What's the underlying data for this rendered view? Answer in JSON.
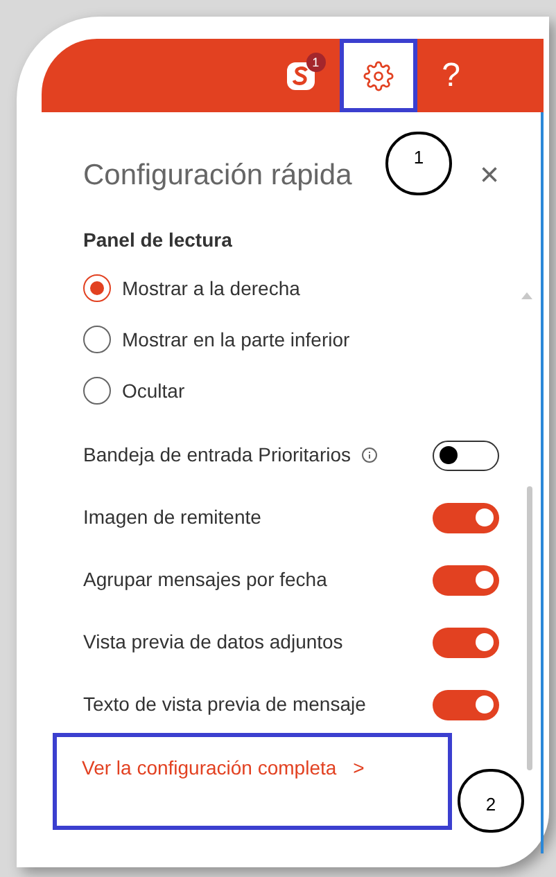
{
  "header": {
    "skype_badge": "1",
    "help_label": "?"
  },
  "panel": {
    "title": "Configuración rápida",
    "close_label": "×",
    "reading_pane": {
      "heading": "Panel de lectura",
      "options": [
        {
          "label": "Mostrar a la derecha",
          "selected": true
        },
        {
          "label": "Mostrar en la parte inferior",
          "selected": false
        },
        {
          "label": "Ocultar",
          "selected": false
        }
      ]
    },
    "toggles": [
      {
        "label": "Bandeja de entrada Prioritarios",
        "info": true,
        "on": false
      },
      {
        "label": "Imagen de remitente",
        "info": false,
        "on": true
      },
      {
        "label": "Agrupar mensajes por fecha",
        "info": false,
        "on": true
      },
      {
        "label": "Vista previa de datos adjuntos",
        "info": false,
        "on": true
      },
      {
        "label": "Texto de vista previa de mensaje",
        "info": false,
        "on": true
      }
    ],
    "footer_link": {
      "label": "Ver la configuración completa",
      "chevron": ">"
    }
  },
  "annotations": [
    {
      "label": "1"
    },
    {
      "label": "2"
    }
  ]
}
